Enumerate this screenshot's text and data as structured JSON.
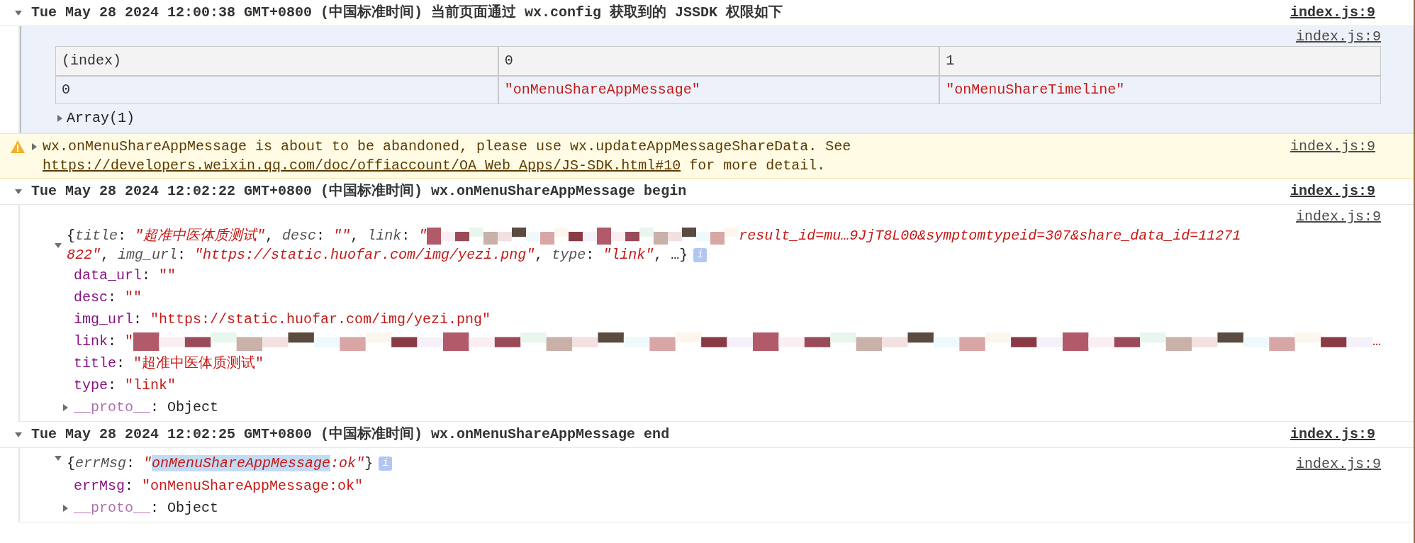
{
  "entries": [
    {
      "kind": "group",
      "expanded": true,
      "title": "Tue May 28 2024 12:00:38 GMT+0800 (中国标准时间) 当前页面通过 wx.config 获取到的 JSSDK 权限如下",
      "source": "index.js:9",
      "items": [
        {
          "kind": "table",
          "source": "index.js:9",
          "columns": [
            "(index)",
            "0",
            "1"
          ],
          "rows": [
            [
              "0",
              "\"onMenuShareAppMessage\"",
              "\"onMenuShareTimeline\""
            ]
          ],
          "footer": {
            "expanded": false,
            "label": "Array(1)"
          }
        }
      ]
    },
    {
      "kind": "warning",
      "expanded": false,
      "before": "wx.onMenuShareAppMessage is about to be abandoned, please use wx.updateAppMessageShareData. See ",
      "link": "https://developers.weixin.qq.com/doc/offiaccount/OA_Web_Apps/JS-SDK.html#10",
      "after": " for more detail.",
      "source": "index.js:9"
    },
    {
      "kind": "group",
      "expanded": true,
      "title": "Tue May 28 2024 12:02:22 GMT+0800 (中国标准时间) wx.onMenuShareAppMessage begin",
      "source": "index.js:9",
      "items": [
        {
          "kind": "object",
          "source": "index.js:9",
          "expanded": true,
          "preview": [
            [
              {
                "kind": "punct",
                "text": "{"
              },
              {
                "kind": "pkey",
                "text": "title"
              },
              {
                "kind": "punct",
                "text": ": "
              },
              {
                "kind": "pstr",
                "text": "\"超准中医体质测试\""
              },
              {
                "kind": "punct",
                "text": ", "
              },
              {
                "kind": "pkey",
                "text": "desc"
              },
              {
                "kind": "punct",
                "text": ": "
              },
              {
                "kind": "pstr",
                "text": "\"\""
              },
              {
                "kind": "punct",
                "text": ", "
              },
              {
                "kind": "pkey",
                "text": "link"
              },
              {
                "kind": "punct",
                "text": ": "
              },
              {
                "kind": "pstr",
                "text": "\""
              },
              {
                "kind": "redaction"
              },
              {
                "kind": "pstr",
                "text": "result_id=mu…9JjT8L00&symptomtypeid=307&share_data_id=11271"
              }
            ],
            [
              {
                "kind": "pstr",
                "text": "822\""
              },
              {
                "kind": "punct",
                "text": ", "
              },
              {
                "kind": "pkey",
                "text": "img_url"
              },
              {
                "kind": "punct",
                "text": ": "
              },
              {
                "kind": "pstr",
                "text": "\"https://static.huofar.com/img/yezi.png\""
              },
              {
                "kind": "punct",
                "text": ", "
              },
              {
                "kind": "pkey",
                "text": "type"
              },
              {
                "kind": "punct",
                "text": ": "
              },
              {
                "kind": "pstr",
                "text": "\"link\""
              },
              {
                "kind": "punct",
                "text": ", …}"
              },
              {
                "kind": "info",
                "text": "i"
              }
            ]
          ],
          "properties": [
            {
              "segments": [
                {
                  "kind": "key",
                  "text": "data_url"
                },
                {
                  "kind": "punct",
                  "text": ": "
                },
                {
                  "kind": "str",
                  "text": "\"\""
                }
              ]
            },
            {
              "segments": [
                {
                  "kind": "key",
                  "text": "desc"
                },
                {
                  "kind": "punct",
                  "text": ": "
                },
                {
                  "kind": "str",
                  "text": "\"\""
                }
              ]
            },
            {
              "segments": [
                {
                  "kind": "key",
                  "text": "img_url"
                },
                {
                  "kind": "punct",
                  "text": ": "
                },
                {
                  "kind": "str",
                  "text": "\"https://static.huofar.com/img/yezi.png\""
                }
              ]
            },
            {
              "segments": [
                {
                  "kind": "key",
                  "text": "link"
                },
                {
                  "kind": "punct",
                  "text": ": "
                },
                {
                  "kind": "str",
                  "text": "\""
                },
                {
                  "kind": "redaction"
                },
                {
                  "kind": "str",
                  "text": "…"
                }
              ]
            },
            {
              "segments": [
                {
                  "kind": "key",
                  "text": "title"
                },
                {
                  "kind": "punct",
                  "text": ": "
                },
                {
                  "kind": "str",
                  "text": "\"超准中医体质测试\""
                }
              ]
            },
            {
              "segments": [
                {
                  "kind": "key",
                  "text": "type"
                },
                {
                  "kind": "punct",
                  "text": ": "
                },
                {
                  "kind": "str",
                  "text": "\"link\""
                }
              ]
            },
            {
              "expanded": false,
              "segments": [
                {
                  "kind": "proto",
                  "text": "__proto__"
                },
                {
                  "kind": "punct",
                  "text": ": Object"
                }
              ]
            }
          ]
        }
      ]
    },
    {
      "kind": "group",
      "expanded": true,
      "title": "Tue May 28 2024 12:02:25 GMT+0800 (中国标准时间) wx.onMenuShareAppMessage end",
      "source": "index.js:9",
      "items": [
        {
          "kind": "object",
          "source": "index.js:9",
          "expanded": true,
          "preview": [
            [
              {
                "kind": "punct",
                "text": "{"
              },
              {
                "kind": "pkey",
                "text": "errMsg"
              },
              {
                "kind": "punct",
                "text": ": "
              },
              {
                "kind": "pstr",
                "text": "\""
              },
              {
                "kind": "pstr",
                "text": "onMenuShareAppMessage",
                "highlighted": true
              },
              {
                "kind": "pstr",
                "text": ":ok\""
              },
              {
                "kind": "punct",
                "text": "}"
              },
              {
                "kind": "info",
                "text": "i"
              }
            ]
          ],
          "properties": [
            {
              "segments": [
                {
                  "kind": "key",
                  "text": "errMsg"
                },
                {
                  "kind": "punct",
                  "text": ": "
                },
                {
                  "kind": "str",
                  "text": "\"onMenuShareAppMessage:ok\""
                }
              ]
            },
            {
              "expanded": false,
              "segments": [
                {
                  "kind": "proto",
                  "text": "__proto__"
                },
                {
                  "kind": "punct",
                  "text": ": Object"
                }
              ]
            }
          ]
        }
      ]
    }
  ]
}
